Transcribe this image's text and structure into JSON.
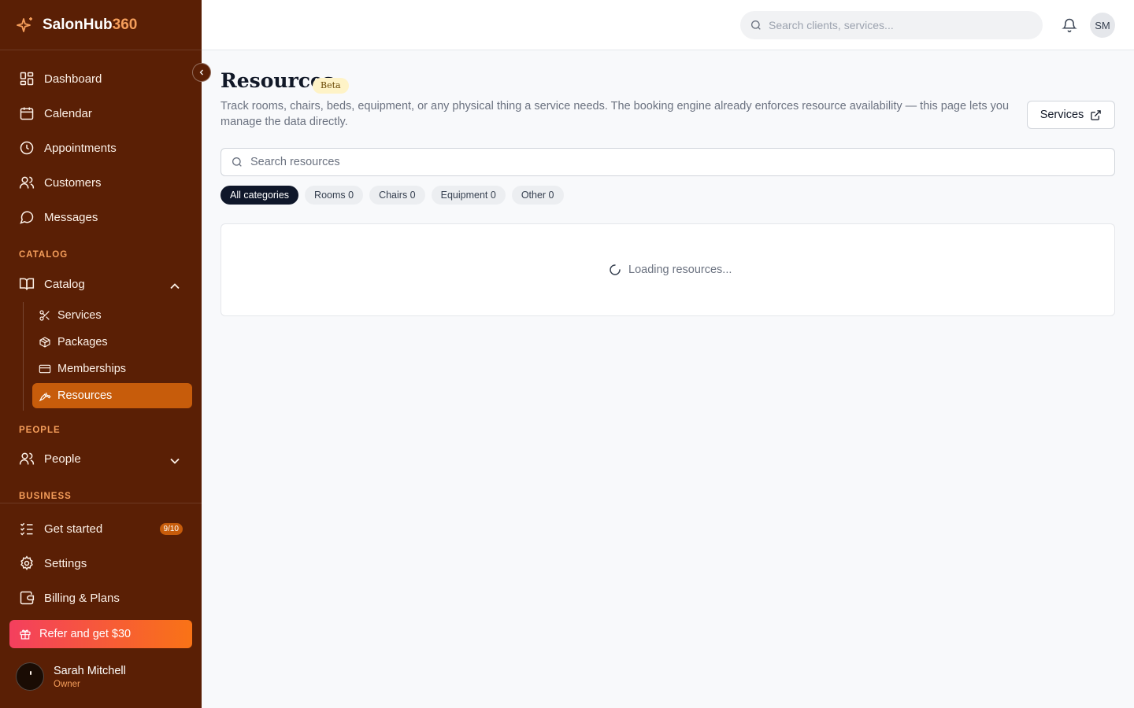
{
  "brand": {
    "name": "SalonHub",
    "suffix": "360"
  },
  "sidebar": {
    "nav": [
      {
        "label": "Dashboard",
        "icon": "dashboard-grid-icon"
      },
      {
        "label": "Calendar",
        "icon": "calendar-icon"
      },
      {
        "label": "Appointments",
        "icon": "clock-icon"
      },
      {
        "label": "Customers",
        "icon": "users-icon"
      },
      {
        "label": "Messages",
        "icon": "message-circle-icon"
      }
    ],
    "catalog_section": "CATALOG",
    "catalog_label": "Catalog",
    "catalog_items": [
      {
        "label": "Services",
        "icon": "scissors-icon"
      },
      {
        "label": "Packages",
        "icon": "package-icon"
      },
      {
        "label": "Memberships",
        "icon": "credit-card-icon"
      },
      {
        "label": "Resources",
        "icon": "wrench-icon",
        "active": true
      }
    ],
    "people_section": "PEOPLE",
    "people_label": "People",
    "business_section": "BUSINESS",
    "get_started": {
      "label": "Get started",
      "badge": "9/10"
    },
    "settings_label": "Settings",
    "billing_label": "Billing & Plans",
    "refer_label": "Refer and get $30",
    "user": {
      "name": "Sarah Mitchell",
      "role": "Owner"
    }
  },
  "header": {
    "search_placeholder": "Search clients, services...",
    "avatar_initials": "SM"
  },
  "main": {
    "title": "Resources",
    "badge": "Beta",
    "description": "Track rooms, chairs, beds, equipment, or any physical thing a service needs. The booking engine already enforces resource availability — this page lets you manage the data directly.",
    "services_button": "Services",
    "search_placeholder": "Search resources",
    "filters": [
      {
        "label": "All categories",
        "active": true
      },
      {
        "label": "Rooms 0"
      },
      {
        "label": "Chairs 0"
      },
      {
        "label": "Equipment 0"
      },
      {
        "label": "Other 0"
      }
    ],
    "loading_text": "Loading resources..."
  },
  "colors": {
    "sidebar_bg": "#5a1f05",
    "accent": "#c75c0b",
    "brand_accent": "#f59e5b",
    "active_chip": "#0f172a"
  }
}
